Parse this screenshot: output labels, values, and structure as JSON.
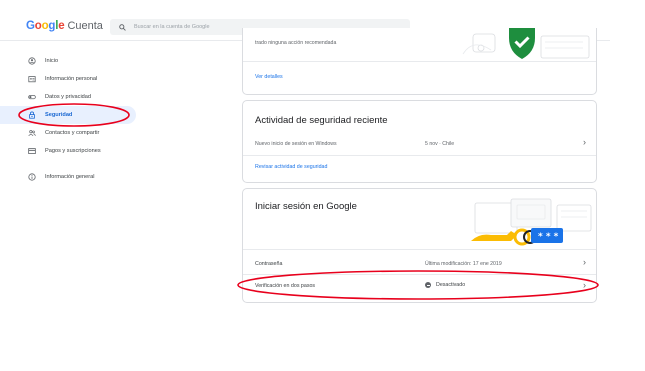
{
  "header": {
    "logo_letters": [
      "G",
      "o",
      "o",
      "g",
      "l",
      "e"
    ],
    "product": "Cuenta",
    "search_placeholder": "Buscar en la cuenta de Google"
  },
  "sidebar": {
    "items": [
      {
        "label": "Inicio",
        "icon": "home-icon"
      },
      {
        "label": "Información personal",
        "icon": "id-card-icon"
      },
      {
        "label": "Datos y privacidad",
        "icon": "toggle-icon"
      },
      {
        "label": "Seguridad",
        "icon": "lock-icon",
        "active": true
      },
      {
        "label": "Contactos y compartir",
        "icon": "people-icon"
      },
      {
        "label": "Pagos y suscripciones",
        "icon": "credit-card-icon"
      },
      {
        "label": "Información general",
        "icon": "info-icon"
      }
    ]
  },
  "security_issues": {
    "text": "trado ninguna acción recomendada",
    "link": "Ver detalles"
  },
  "recent_activity": {
    "title": "Actividad de seguridad reciente",
    "event": "Nuevo inicio de sesión en Windows",
    "event_meta": "5 nov · Chile",
    "link": "Revisar actividad de seguridad"
  },
  "signin": {
    "title": "Iniciar sesión en Google",
    "password_label": "Contraseña",
    "password_meta": "Última modificación: 17 ene 2019",
    "two_step_label": "Verificación en dos pasos",
    "two_step_status": "Desactivado"
  },
  "colors": {
    "accent": "#1a73e8",
    "annotation": "#e8001c",
    "active_bg": "#e8f0fe",
    "shield": "#1e8e3e",
    "key": "#fbbc04"
  }
}
